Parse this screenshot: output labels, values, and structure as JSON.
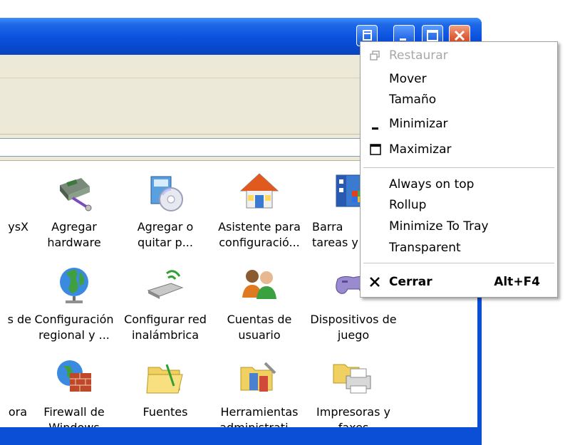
{
  "window": {
    "title_buttons": [
      "system-menu",
      "minimize",
      "maximize",
      "close"
    ]
  },
  "control_panel": {
    "items": [
      {
        "label": "ysX",
        "icon": "program-icon"
      },
      {
        "label": "Agregar\nhardware",
        "icon": "add-hardware-icon"
      },
      {
        "label": "Agregar o\nquitar p...",
        "icon": "add-remove-programs-icon"
      },
      {
        "label": "Asistente para\nconfiguració...",
        "icon": "network-setup-house-icon"
      },
      {
        "label": "Barra\ntareas y",
        "icon": "taskbar-icon"
      },
      {
        "label": "s de",
        "icon": "program-icon"
      },
      {
        "label": "Configuración\nregional y ...",
        "icon": "globe-icon"
      },
      {
        "label": "Configurar red\ninalámbrica",
        "icon": "wireless-adapter-icon"
      },
      {
        "label": "Cuentas de\nusuario",
        "icon": "user-accounts-icon"
      },
      {
        "label": "Dispositivos de\njuego",
        "icon": "gamepad-icon"
      },
      {
        "label": "ora",
        "icon": "program-icon"
      },
      {
        "label": "Firewall de\nWindows",
        "icon": "firewall-icon"
      },
      {
        "label": "Fuentes",
        "icon": "fonts-folder-icon"
      },
      {
        "label": "Herramientas\nadministrati...",
        "icon": "admin-tools-icon"
      },
      {
        "label": "Impresoras y\nfaxes",
        "icon": "printer-icon"
      }
    ]
  },
  "system_menu": {
    "items": [
      {
        "label": "Restaurar",
        "disabled": true,
        "glyph": "restore-icon"
      },
      {
        "label": "Mover"
      },
      {
        "label": "Tamaño"
      },
      {
        "label": "Minimizar",
        "glyph": "minimize-icon"
      },
      {
        "label": "Maximizar",
        "glyph": "maximize-icon"
      },
      {
        "label": "Always on top"
      },
      {
        "label": "Rollup"
      },
      {
        "label": "Minimize To Tray"
      },
      {
        "label": "Transparent"
      },
      {
        "label": "Cerrar",
        "shortcut": "Alt+F4",
        "bold": true,
        "glyph": "close-icon"
      }
    ]
  },
  "colors": {
    "titlebar": "#0a50de",
    "chrome": "#ece9d8",
    "menu_bg": "#ffffff",
    "disabled_text": "#a8a8a8"
  }
}
